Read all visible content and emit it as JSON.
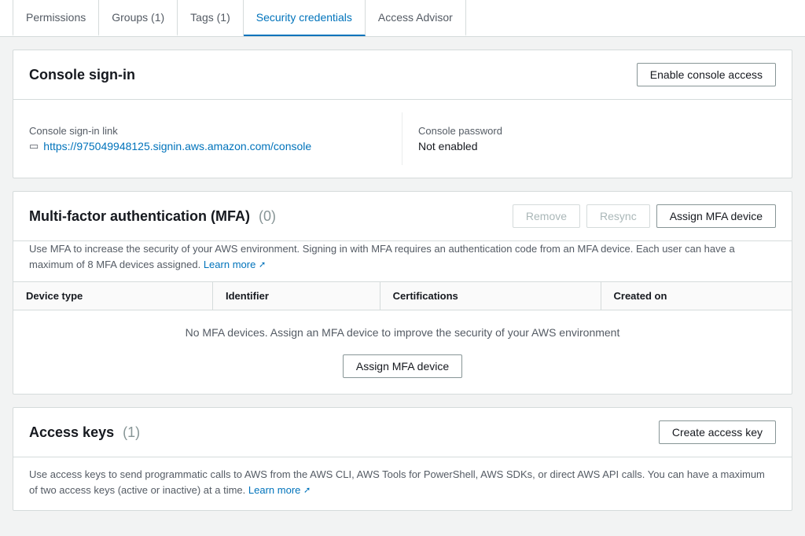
{
  "tabs": [
    {
      "id": "permissions",
      "label": "Permissions",
      "active": false
    },
    {
      "id": "groups",
      "label": "Groups (1)",
      "active": false
    },
    {
      "id": "tags",
      "label": "Tags (1)",
      "active": false
    },
    {
      "id": "security-credentials",
      "label": "Security credentials",
      "active": true
    },
    {
      "id": "access-advisor",
      "label": "Access Advisor",
      "active": false
    }
  ],
  "console_signin": {
    "title": "Console sign-in",
    "enable_button": "Enable console access",
    "signin_link_label": "Console sign-in link",
    "signin_link_url": "https://975049948125.signin.aws.amazon.com/console",
    "password_label": "Console password",
    "password_value": "Not enabled"
  },
  "mfa": {
    "title": "Multi-factor authentication (MFA)",
    "count": "(0)",
    "remove_button": "Remove",
    "resync_button": "Resync",
    "assign_button": "Assign MFA device",
    "description": "Use MFA to increase the security of your AWS environment. Signing in with MFA requires an authentication code from an MFA device. Each user can have a maximum of 8 MFA devices assigned.",
    "learn_more": "Learn more",
    "table_headers": [
      "Device type",
      "Identifier",
      "Certifications",
      "Created on"
    ],
    "empty_message": "No MFA devices. Assign an MFA device to improve the security of your AWS environment",
    "assign_mfa_button": "Assign MFA device"
  },
  "access_keys": {
    "title": "Access keys",
    "count": "(1)",
    "create_button": "Create access key",
    "description": "Use access keys to send programmatic calls to AWS from the AWS CLI, AWS Tools for PowerShell, AWS SDKs, or direct AWS API calls. You can have a maximum of two access keys (active or inactive) at a time.",
    "learn_more": "Learn more"
  }
}
